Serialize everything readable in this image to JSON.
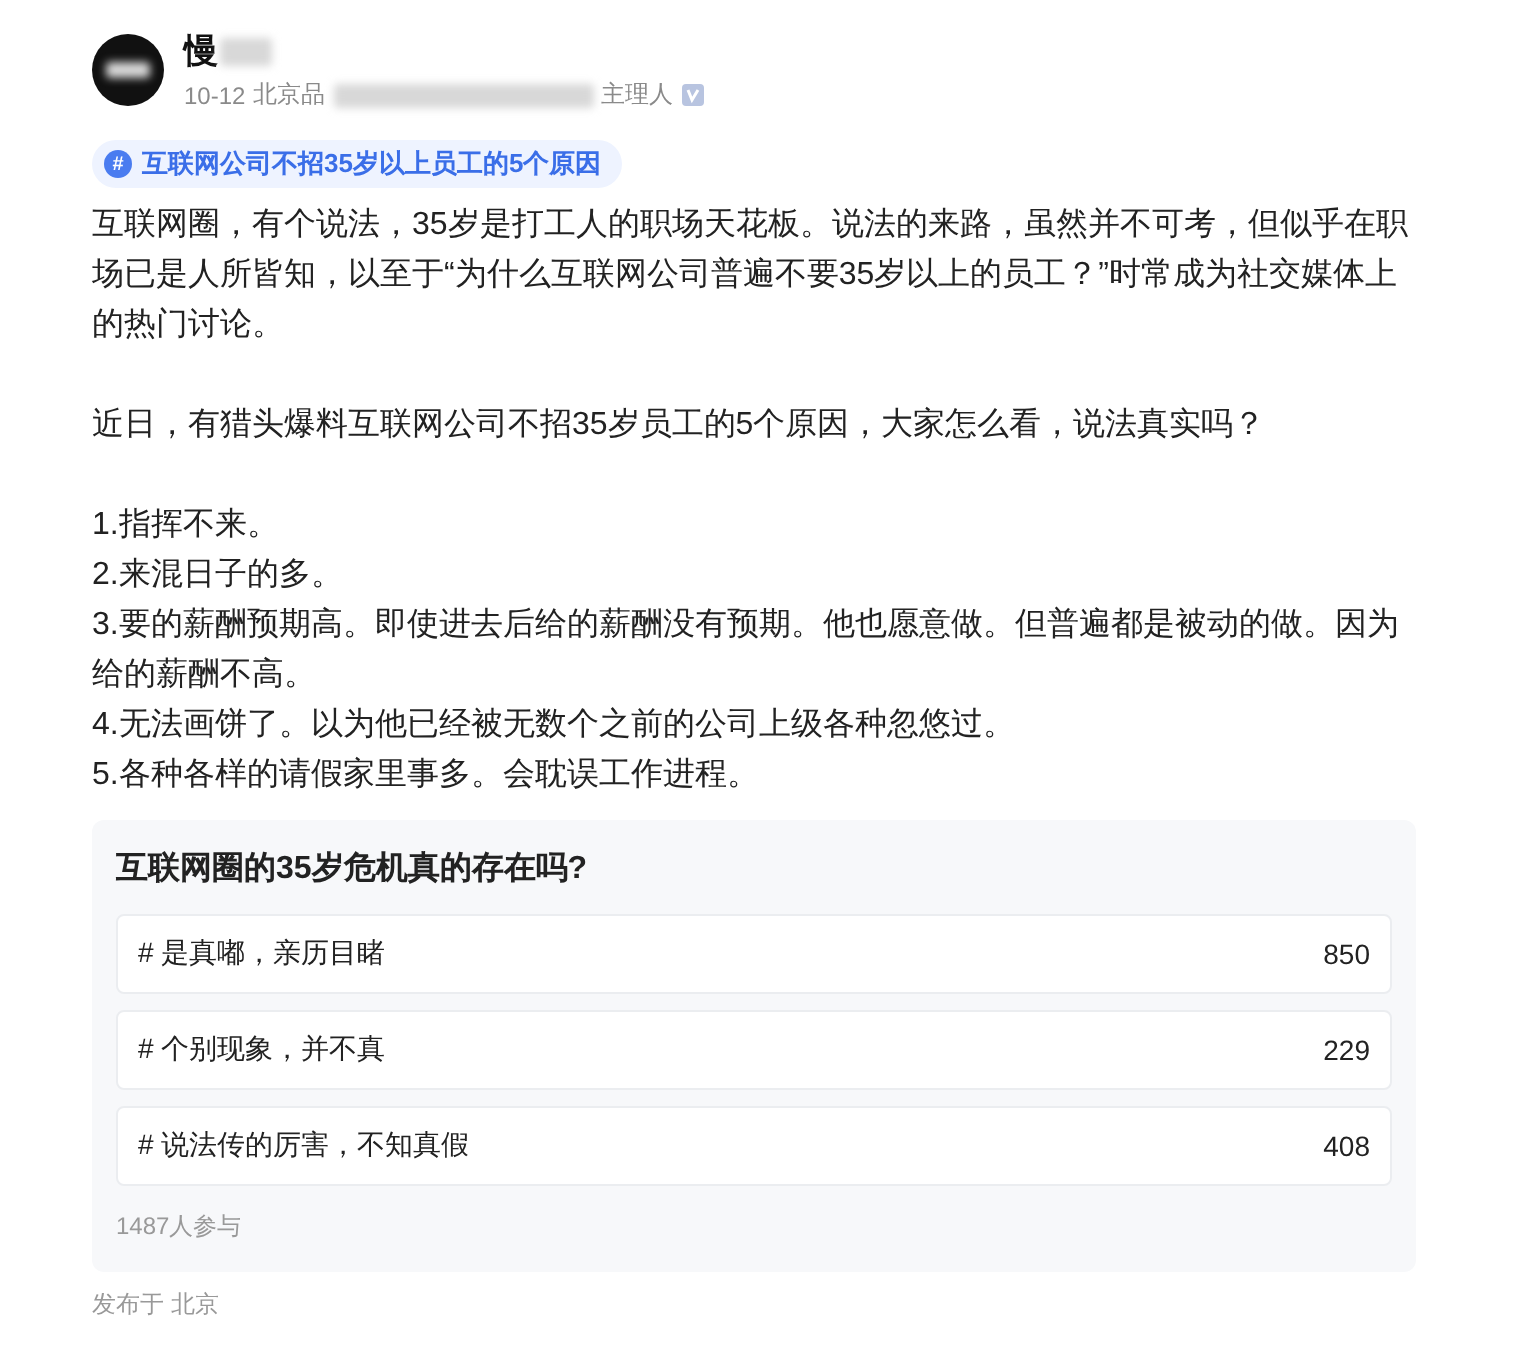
{
  "author": {
    "name": "慢",
    "date": "10-12",
    "location_text": "北京品",
    "role_text": "主理人"
  },
  "topic": {
    "icon": "#",
    "label": "互联网公司不招35岁以上员工的5个原因"
  },
  "paragraphs": [
    "互联网圈，有个说法，35岁是打工人的职场天花板。说法的来路，虽然并不可考，但似乎在职场已是人所皆知，以至于“为什么互联网公司普遍不要35岁以上的员工？”时常成为社交媒体上的热门讨论。",
    "近日，有猎头爆料互联网公司不招35岁员工的5个原因，大家怎么看，说法真实吗？"
  ],
  "list": [
    "1.指挥不来。",
    "2.来混日子的多。",
    "3.要的薪酬预期高。即使进去后给的薪酬没有预期。他也愿意做。但普遍都是被动的做。因为给的薪酬不高。",
    "4.无法画饼了。以为他已经被无数个之前的公司上级各种忽悠过。",
    "5.各种各样的请假家里事多。会耽误工作进程。"
  ],
  "poll": {
    "title": "互联网圈的35岁危机真的存在吗?",
    "options": [
      {
        "label": "# 是真嘟，亲历目睹",
        "count": "850"
      },
      {
        "label": "# 个别现象，并不真",
        "count": "229"
      },
      {
        "label": "# 说法传的厉害，不知真假",
        "count": "408"
      }
    ],
    "participants": "1487人参与"
  },
  "footer": "发布于 北京"
}
